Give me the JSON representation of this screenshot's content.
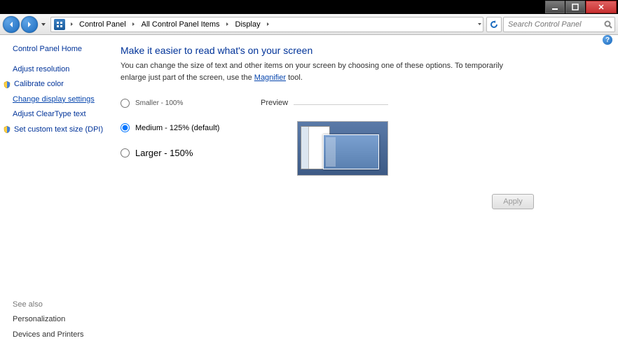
{
  "titlebar": {},
  "address": {
    "crumbs": [
      "Control Panel",
      "All Control Panel Items",
      "Display"
    ],
    "search_placeholder": "Search Control Panel"
  },
  "sidebar": {
    "home": "Control Panel Home",
    "links": [
      {
        "label": "Adjust resolution",
        "shield": false
      },
      {
        "label": "Calibrate color",
        "shield": true
      },
      {
        "label": "Change display settings",
        "shield": false,
        "selected": true
      },
      {
        "label": "Adjust ClearType text",
        "shield": false
      },
      {
        "label": "Set custom text size (DPI)",
        "shield": true
      }
    ],
    "see_also_title": "See also",
    "see_also": [
      "Personalization",
      "Devices and Printers"
    ]
  },
  "main": {
    "title": "Make it easier to read what's on your screen",
    "desc_before": "You can change the size of text and other items on your screen by choosing one of these options. To temporarily enlarge just part of the screen, use the ",
    "desc_link": "Magnifier",
    "desc_after": " tool.",
    "options": [
      {
        "label": "Smaller - 100%",
        "value": "100",
        "selected": false,
        "size": "small"
      },
      {
        "label": "Medium - 125% (default)",
        "value": "125",
        "selected": true,
        "size": "medium"
      },
      {
        "label": "Larger - 150%",
        "value": "150",
        "selected": false,
        "size": "large"
      }
    ],
    "preview_label": "Preview",
    "apply_label": "Apply"
  }
}
